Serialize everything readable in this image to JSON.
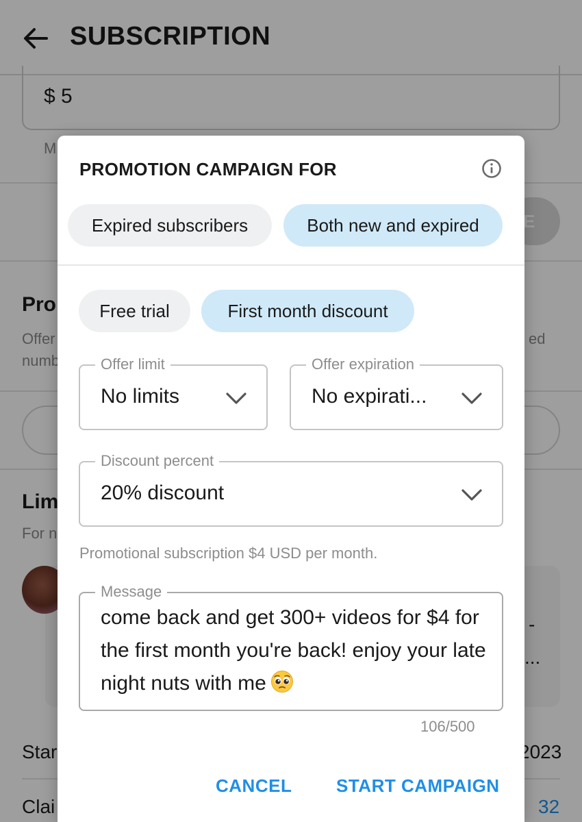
{
  "appbar": {
    "title": "SUBSCRIPTION"
  },
  "background": {
    "price_value": "$ 5",
    "price_hint_fragment": "M",
    "section1_heading_fragment": "Pro",
    "section1_text_line1_fragment": "Offer",
    "section1_text_line1_right_fragment": "ed",
    "section1_text_line2_fragment": "numb",
    "button_fragment": "E",
    "section2_heading_fragment": "Lim",
    "section2_text_fragment": "For n",
    "card_right_fragment1": "-",
    "card_right_fragment2": "...",
    "row1_label_fragment": "Star",
    "row1_value_fragment": "2023",
    "row2_label_fragment": "Clai",
    "row2_value": "32"
  },
  "modal": {
    "title": "PROMOTION CAMPAIGN FOR",
    "audience_options": [
      {
        "label": "Expired subscribers",
        "selected": false
      },
      {
        "label": "Both new and expired",
        "selected": true
      }
    ],
    "type_options": [
      {
        "label": "Free trial",
        "selected": false
      },
      {
        "label": "First month discount",
        "selected": true
      }
    ],
    "offer_limit": {
      "label": "Offer limit",
      "value": "No limits"
    },
    "offer_expiration": {
      "label": "Offer expiration",
      "value": "No expirati..."
    },
    "discount_percent": {
      "label": "Discount percent",
      "value": "20% discount"
    },
    "helper_text": "Promotional subscription $4 USD per month.",
    "message": {
      "label": "Message",
      "value": "come back and get 300+ videos for $4 for the first month you're back! enjoy your late night nuts with me",
      "counter": "106/500"
    },
    "cancel_label": "CANCEL",
    "start_label": "START CAMPAIGN"
  },
  "colors": {
    "accent": "#1f8fe6",
    "chip_selected": "#cfe9f8",
    "chip_unselected": "#eff0f2"
  }
}
